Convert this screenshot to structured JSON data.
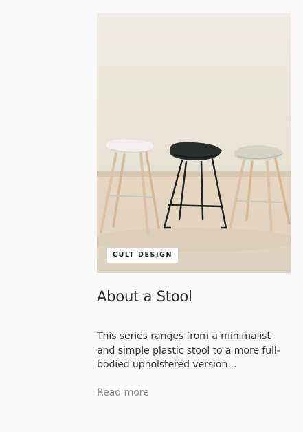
{
  "post": {
    "category": "CULT DESIGN",
    "title": "About a Stool",
    "excerpt": "This series ranges from a minimalist and simple plastic stool to a more full-bodied upholstered version...",
    "read_more": "Read more"
  },
  "image": {
    "subject": "three bar stools: white, black, sage",
    "colors": {
      "wall": "#ece8dc",
      "floor": "#e6d8c4",
      "wood": "#dcc3a6",
      "white_seat": "#f1f0ec",
      "black_seat": "#2a2d2b",
      "sage_seat": "#d3d4c6"
    }
  },
  "colors": {
    "page_bg": "#fafafa",
    "title": "#2a2a2a",
    "body": "#3a3a3a",
    "link": "#8a8a8a"
  }
}
